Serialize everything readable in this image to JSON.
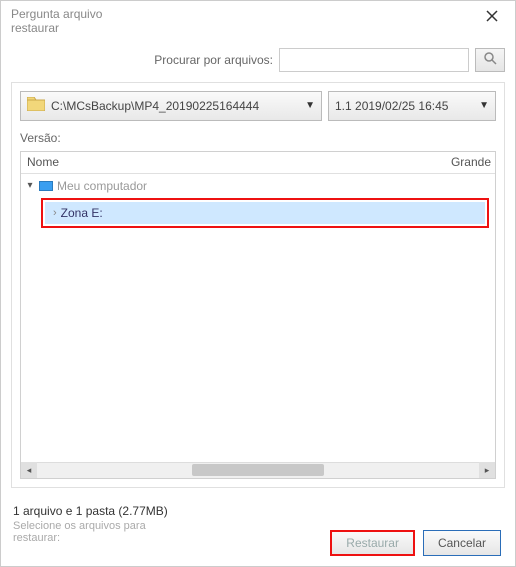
{
  "window": {
    "title_line1": "Pergunta arquivo",
    "title_line2": "restaurar"
  },
  "search": {
    "label": "Procurar por arquivos:",
    "value": "",
    "placeholder": "",
    "icon": "search-icon"
  },
  "path_dropdown": {
    "icon": "folder-icon",
    "value": "C:\\MCsBackup\\MP4_20190225164444"
  },
  "version_dropdown": {
    "value": "1.1  2019/02/25 16:45"
  },
  "version_label": "Versão:",
  "columns": {
    "name": "Nome",
    "size": "Grande"
  },
  "tree": {
    "root": {
      "label": "Meu computador",
      "expanded": true
    },
    "child": {
      "label": "Zona E:",
      "expanded": false
    }
  },
  "footer": {
    "status": "1 arquivo e 1 pasta (2.77MB)",
    "hint_line1": "Selecione os arquivos para",
    "hint_line2": "restaurar:"
  },
  "buttons": {
    "restore": "Restaurar",
    "cancel": "Cancelar"
  }
}
